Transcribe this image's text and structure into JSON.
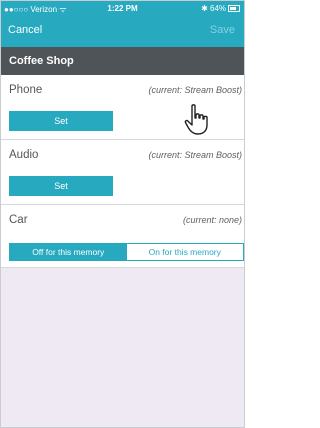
{
  "status_bar": {
    "carrier": "●●○○○ Verizon ᯤ",
    "time": "1:22 PM",
    "bluetooth_battery": "✱ 64%"
  },
  "nav": {
    "cancel_label": "Cancel",
    "save_label": "Save"
  },
  "section": {
    "title": "Coffee Shop"
  },
  "rows": [
    {
      "label": "Phone",
      "current": "(current: Stream Boost)",
      "button_label": "Set"
    },
    {
      "label": "Audio",
      "current": "(current: Stream Boost)",
      "button_label": "Set"
    },
    {
      "label": "Car",
      "current": "(current: none)"
    }
  ],
  "car_toggle": {
    "off_label": "Off for this memory",
    "on_label": "On for this memory",
    "selected": "off"
  },
  "colors": {
    "accent": "#27a9c0",
    "header": "#4f5459",
    "background": "#efe9f3"
  },
  "icons": [
    "hand-pointer-icon",
    "battery-icon"
  ]
}
